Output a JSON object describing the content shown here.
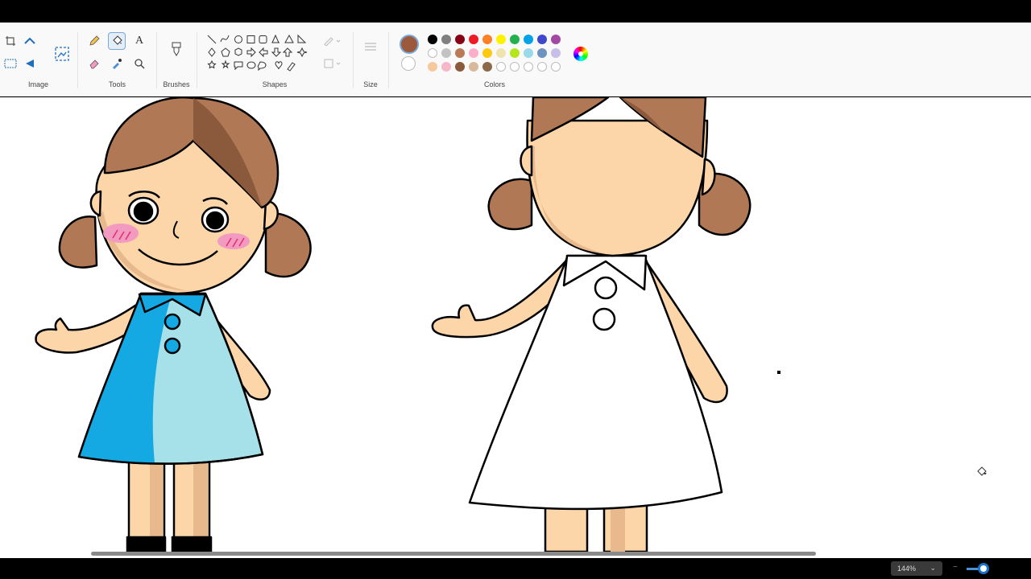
{
  "ribbon": {
    "groups": {
      "image": "Image",
      "tools": "Tools",
      "brushes": "Brushes",
      "shapes": "Shapes",
      "size": "Size",
      "colors": "Colors"
    },
    "tools": {
      "text_glyph": "A"
    },
    "colors": {
      "selected_primary": "#9b5a3c",
      "selected_secondary": "#ffffff",
      "palette": [
        "#000000",
        "#7f7f7f",
        "#880015",
        "#ed1c24",
        "#ff7f27",
        "#fff200",
        "#22b14c",
        "#00a2e8",
        "#3f48cc",
        "#a349a4",
        "#ffffff",
        "#c3c3c3",
        "#b97a57",
        "#ffaec9",
        "#ffc90e",
        "#efe4b0",
        "#b5e61d",
        "#99d9ea",
        "#7092be",
        "#c8bfe7",
        "#f5c99b",
        "#f6b8c8",
        "#8b5a3c",
        "#d9b99b",
        "#8b6a4c",
        "empty",
        "empty",
        "empty",
        "empty",
        "empty"
      ]
    }
  },
  "canvas": {
    "description_colors": {
      "hair": "#b07855",
      "hair_shadow": "#8b5a3c",
      "skin": "#fcd5a8",
      "skin_shadow": "#e8b98c",
      "dress_dark": "#14a9e3",
      "dress_light": "#a6e1ea",
      "cheek": "#f29ac0",
      "outline": "#000000"
    }
  },
  "status": {
    "zoom": "144%"
  }
}
